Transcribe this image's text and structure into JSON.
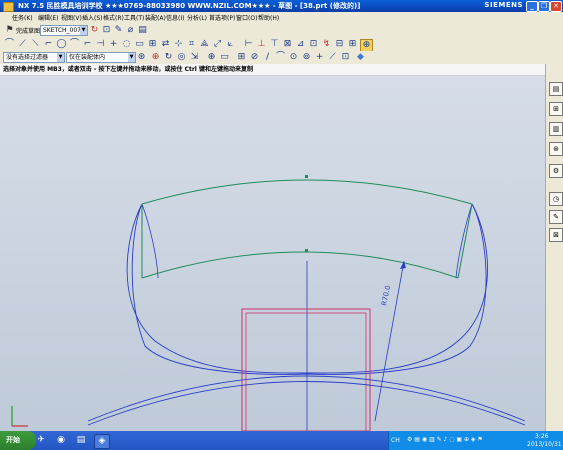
{
  "window": {
    "title": "NX 7.5  民胜模具培训学校  ★★★0769-88033980  WWW.NZIL.COM★★★ - 草图 - [38.prt (修改的)]",
    "brand": "SIEMENS",
    "controls": {
      "minimize": "_",
      "restore": "❐",
      "close": "✕"
    }
  },
  "menu": [
    "任务(K)",
    "编辑(E)",
    "视图(V)",
    "插入(S)",
    "格式(R)",
    "工具(T)",
    "装配(A)",
    "信息(I)",
    "分析(L)",
    "首选项(P)",
    "窗口(O)",
    "帮助(H)"
  ],
  "toolbar1": {
    "finish_sketch_label": "完成草图",
    "sketch_name": "SKETCH_007",
    "icons": [
      "↻",
      "⊡",
      "✎",
      "⌀",
      "▤"
    ]
  },
  "toolbar2": {
    "icons": [
      "⌒",
      "⟋",
      "⟍",
      "⌐",
      "◯",
      "⌒",
      "⌐",
      "⊣",
      "+",
      "◌",
      "▭",
      "⊞",
      "⇄",
      "⊹",
      "⌗",
      "⟁",
      "⤢",
      "⟀",
      "⊢",
      "⊥",
      "⊤",
      "⊠",
      "⊿",
      "⊡",
      "↯",
      "⊟",
      "⊞",
      "⊕"
    ]
  },
  "toolbar3": {
    "selection_filter": "没有选择过滤器",
    "assembly_scope": "仅在装配体内",
    "icons": [
      "⊛",
      "⊕",
      "↻",
      "◎",
      "⇲",
      "⊕",
      "▭",
      "⊞",
      "⊘",
      "/",
      "⌒",
      "⊙",
      "⊚",
      "+",
      "⟋",
      "⊡",
      "◆"
    ]
  },
  "cue_line": "选择对象并使用 MB3，或者双击 - 按下左键并拖动来移动，或按住 Ctrl 键和左键拖动来复制",
  "dimension_label": "R70.0",
  "right_bar_icons": [
    "▤",
    "⊞",
    "▥",
    "⊛",
    "⚙",
    "◷",
    "✎",
    "⊠"
  ],
  "taskbar": {
    "start_label": "开始",
    "quick_icons": [
      "✈",
      "◉",
      "▤",
      "◈"
    ],
    "tray_lang": "CH",
    "clock_time": "3:26",
    "clock_date": "2013/10/31"
  }
}
